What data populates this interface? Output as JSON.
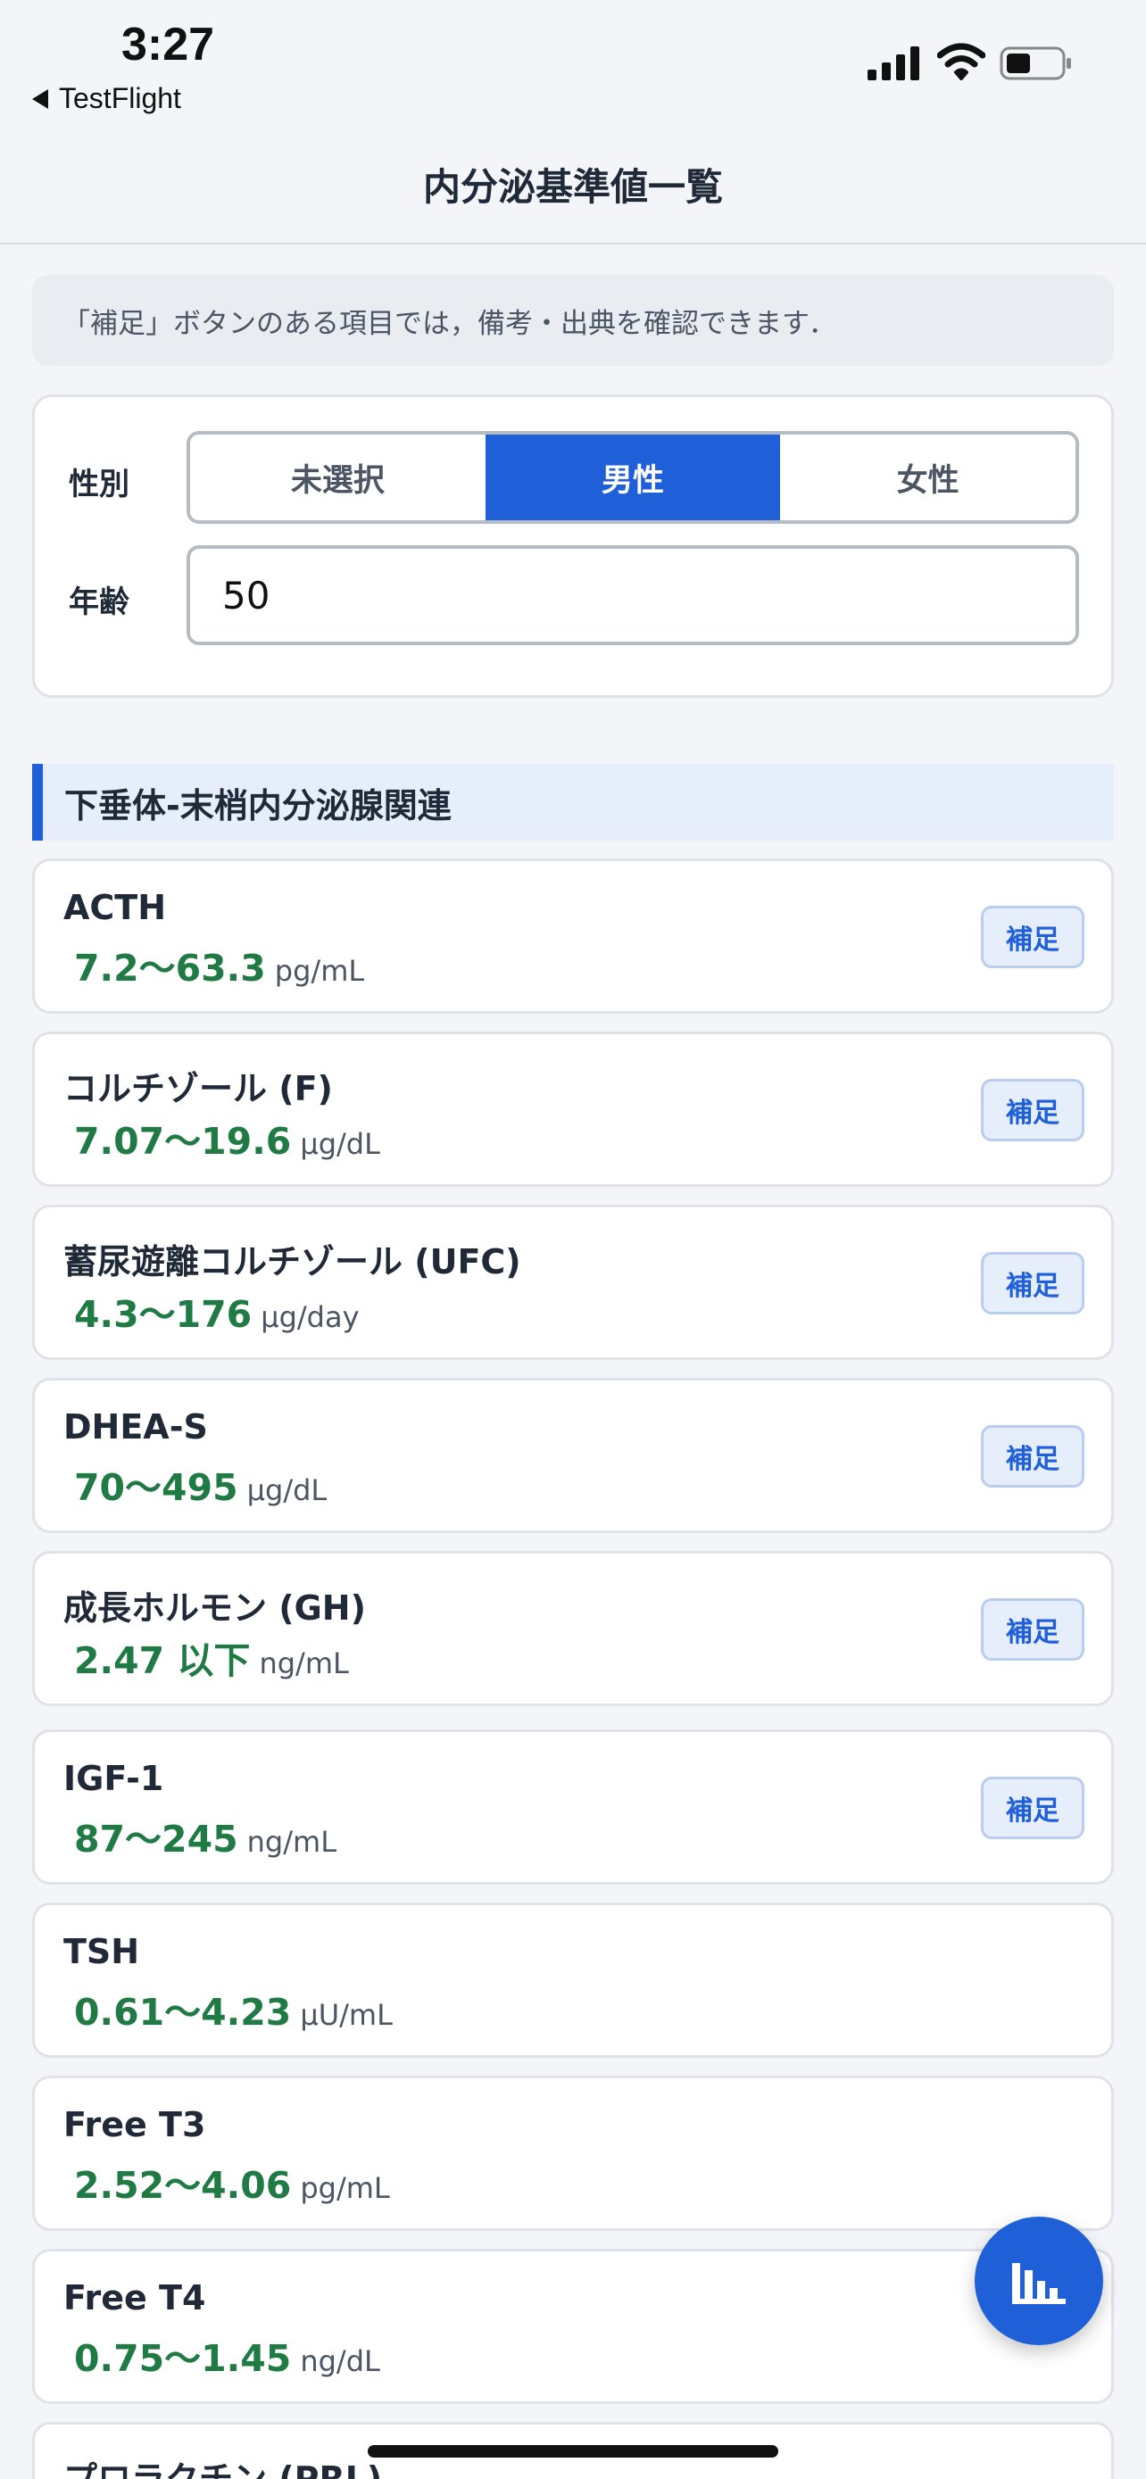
{
  "status_bar": {
    "time": "3:27",
    "back_app": "TestFlight",
    "icons": [
      "signal-icon",
      "wifi-icon",
      "battery-icon"
    ]
  },
  "nav": {
    "title": "内分泌基準値一覧"
  },
  "info_note": "「補足」ボタンのある項目では，備考・出典を確認できます．",
  "filters": {
    "sex_label": "性別",
    "sex_options": [
      "未選択",
      "男性",
      "女性"
    ],
    "sex_selected": "男性",
    "age_label": "年齢",
    "age_value": "50"
  },
  "section": {
    "title": "下垂体-末梢内分泌腺関連"
  },
  "items": [
    {
      "name": "ACTH",
      "range": "7.2〜63.3",
      "unit": "pg/mL",
      "has_note": true
    },
    {
      "name": "コルチゾール (F)",
      "range": "7.07〜19.6",
      "unit": "µg/dL",
      "has_note": true
    },
    {
      "name": "蓄尿遊離コルチゾール (UFC)",
      "range": "4.3〜176",
      "unit": "µg/day",
      "has_note": true
    },
    {
      "name": "DHEA-S",
      "range": "70〜495",
      "unit": "µg/dL",
      "has_note": true
    },
    {
      "name": "成長ホルモン (GH)",
      "range": "2.47 以下",
      "unit": "ng/mL",
      "has_note": true
    },
    {
      "name": "IGF-1",
      "range": "87〜245",
      "unit": "ng/mL",
      "has_note": true
    },
    {
      "name": "TSH",
      "range": "0.61〜4.23",
      "unit": "µU/mL",
      "has_note": false
    },
    {
      "name": "Free T3",
      "range": "2.52〜4.06",
      "unit": "pg/mL",
      "has_note": false
    },
    {
      "name": "Free T4",
      "range": "0.75〜1.45",
      "unit": "ng/dL",
      "has_note": false
    },
    {
      "name": "プロラクチン (PRL)",
      "range": "",
      "unit": "",
      "has_note": false
    }
  ],
  "note_button_label": "補足",
  "fab": {
    "icon": "bar-chart-icon"
  },
  "colors": {
    "accent": "#1f5fd8",
    "range_green": "#1f7a44",
    "background": "#f3f5f9"
  }
}
